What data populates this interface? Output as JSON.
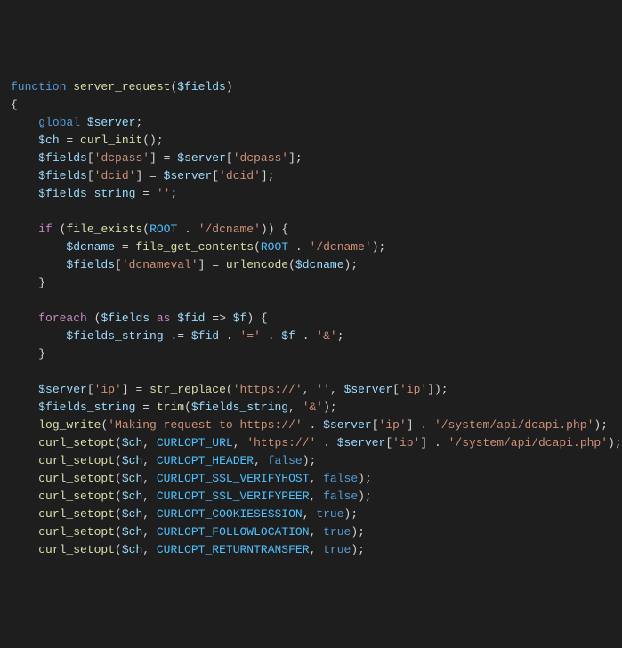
{
  "code": {
    "lines": [
      [
        {
          "t": "function ",
          "c": "keyword"
        },
        {
          "t": "server_request",
          "c": "function"
        },
        {
          "t": "(",
          "c": "punct"
        },
        {
          "t": "$fields",
          "c": "variable"
        },
        {
          "t": ")",
          "c": "punct"
        }
      ],
      [
        {
          "t": "{",
          "c": "punct"
        }
      ],
      [
        {
          "t": "    ",
          "c": "punct"
        },
        {
          "t": "global ",
          "c": "keyword"
        },
        {
          "t": "$server",
          "c": "variable"
        },
        {
          "t": ";",
          "c": "punct"
        }
      ],
      [
        {
          "t": "    ",
          "c": "punct"
        },
        {
          "t": "$ch",
          "c": "variable"
        },
        {
          "t": " = ",
          "c": "operator"
        },
        {
          "t": "curl_init",
          "c": "function"
        },
        {
          "t": "();",
          "c": "punct"
        }
      ],
      [
        {
          "t": "    ",
          "c": "punct"
        },
        {
          "t": "$fields",
          "c": "variable"
        },
        {
          "t": "[",
          "c": "punct"
        },
        {
          "t": "'dcpass'",
          "c": "string"
        },
        {
          "t": "] = ",
          "c": "punct"
        },
        {
          "t": "$server",
          "c": "variable"
        },
        {
          "t": "[",
          "c": "punct"
        },
        {
          "t": "'dcpass'",
          "c": "string"
        },
        {
          "t": "];",
          "c": "punct"
        }
      ],
      [
        {
          "t": "    ",
          "c": "punct"
        },
        {
          "t": "$fields",
          "c": "variable"
        },
        {
          "t": "[",
          "c": "punct"
        },
        {
          "t": "'dcid'",
          "c": "string"
        },
        {
          "t": "] = ",
          "c": "punct"
        },
        {
          "t": "$server",
          "c": "variable"
        },
        {
          "t": "[",
          "c": "punct"
        },
        {
          "t": "'dcid'",
          "c": "string"
        },
        {
          "t": "];",
          "c": "punct"
        }
      ],
      [
        {
          "t": "    ",
          "c": "punct"
        },
        {
          "t": "$fields_string",
          "c": "variable"
        },
        {
          "t": " = ",
          "c": "operator"
        },
        {
          "t": "''",
          "c": "string"
        },
        {
          "t": ";",
          "c": "punct"
        }
      ],
      [],
      [
        {
          "t": "    ",
          "c": "punct"
        },
        {
          "t": "if ",
          "c": "keyword-control"
        },
        {
          "t": "(",
          "c": "punct"
        },
        {
          "t": "file_exists",
          "c": "function"
        },
        {
          "t": "(",
          "c": "punct"
        },
        {
          "t": "ROOT",
          "c": "constant"
        },
        {
          "t": " . ",
          "c": "operator"
        },
        {
          "t": "'/dcname'",
          "c": "string"
        },
        {
          "t": ")) {",
          "c": "punct"
        }
      ],
      [
        {
          "t": "        ",
          "c": "punct"
        },
        {
          "t": "$dcname",
          "c": "variable"
        },
        {
          "t": " = ",
          "c": "operator"
        },
        {
          "t": "file_get_contents",
          "c": "function"
        },
        {
          "t": "(",
          "c": "punct"
        },
        {
          "t": "ROOT",
          "c": "constant"
        },
        {
          "t": " . ",
          "c": "operator"
        },
        {
          "t": "'/dcname'",
          "c": "string"
        },
        {
          "t": ");",
          "c": "punct"
        }
      ],
      [
        {
          "t": "        ",
          "c": "punct"
        },
        {
          "t": "$fields",
          "c": "variable"
        },
        {
          "t": "[",
          "c": "punct"
        },
        {
          "t": "'dcnameval'",
          "c": "string"
        },
        {
          "t": "] = ",
          "c": "punct"
        },
        {
          "t": "urlencode",
          "c": "function"
        },
        {
          "t": "(",
          "c": "punct"
        },
        {
          "t": "$dcname",
          "c": "variable"
        },
        {
          "t": ");",
          "c": "punct"
        }
      ],
      [
        {
          "t": "    }",
          "c": "punct"
        }
      ],
      [],
      [
        {
          "t": "    ",
          "c": "punct"
        },
        {
          "t": "foreach ",
          "c": "keyword-control"
        },
        {
          "t": "(",
          "c": "punct"
        },
        {
          "t": "$fields",
          "c": "variable"
        },
        {
          "t": " as ",
          "c": "keyword-control"
        },
        {
          "t": "$fid",
          "c": "variable"
        },
        {
          "t": " => ",
          "c": "operator"
        },
        {
          "t": "$f",
          "c": "variable"
        },
        {
          "t": ") {",
          "c": "punct"
        }
      ],
      [
        {
          "t": "        ",
          "c": "punct"
        },
        {
          "t": "$fields_string",
          "c": "variable"
        },
        {
          "t": " .= ",
          "c": "operator"
        },
        {
          "t": "$fid",
          "c": "variable"
        },
        {
          "t": " . ",
          "c": "operator"
        },
        {
          "t": "'='",
          "c": "string"
        },
        {
          "t": " . ",
          "c": "operator"
        },
        {
          "t": "$f",
          "c": "variable"
        },
        {
          "t": " . ",
          "c": "operator"
        },
        {
          "t": "'&'",
          "c": "string"
        },
        {
          "t": ";",
          "c": "punct"
        }
      ],
      [
        {
          "t": "    }",
          "c": "punct"
        }
      ],
      [],
      [
        {
          "t": "    ",
          "c": "punct"
        },
        {
          "t": "$server",
          "c": "variable"
        },
        {
          "t": "[",
          "c": "punct"
        },
        {
          "t": "'ip'",
          "c": "string"
        },
        {
          "t": "] = ",
          "c": "punct"
        },
        {
          "t": "str_replace",
          "c": "function"
        },
        {
          "t": "(",
          "c": "punct"
        },
        {
          "t": "'https://'",
          "c": "string"
        },
        {
          "t": ", ",
          "c": "punct"
        },
        {
          "t": "''",
          "c": "string"
        },
        {
          "t": ", ",
          "c": "punct"
        },
        {
          "t": "$server",
          "c": "variable"
        },
        {
          "t": "[",
          "c": "punct"
        },
        {
          "t": "'ip'",
          "c": "string"
        },
        {
          "t": "]);",
          "c": "punct"
        }
      ],
      [
        {
          "t": "    ",
          "c": "punct"
        },
        {
          "t": "$fields_string",
          "c": "variable"
        },
        {
          "t": " = ",
          "c": "operator"
        },
        {
          "t": "trim",
          "c": "function"
        },
        {
          "t": "(",
          "c": "punct"
        },
        {
          "t": "$fields_string",
          "c": "variable"
        },
        {
          "t": ", ",
          "c": "punct"
        },
        {
          "t": "'&'",
          "c": "string"
        },
        {
          "t": ");",
          "c": "punct"
        }
      ],
      [
        {
          "t": "    ",
          "c": "punct"
        },
        {
          "t": "log_write",
          "c": "function"
        },
        {
          "t": "(",
          "c": "punct"
        },
        {
          "t": "'Making request to https://'",
          "c": "string"
        },
        {
          "t": " . ",
          "c": "operator"
        },
        {
          "t": "$server",
          "c": "variable"
        },
        {
          "t": "[",
          "c": "punct"
        },
        {
          "t": "'ip'",
          "c": "string"
        },
        {
          "t": "] . ",
          "c": "punct"
        },
        {
          "t": "'/system/api/dcapi.php'",
          "c": "string"
        },
        {
          "t": ");",
          "c": "punct"
        }
      ],
      [
        {
          "t": "    ",
          "c": "punct"
        },
        {
          "t": "curl_setopt",
          "c": "function"
        },
        {
          "t": "(",
          "c": "punct"
        },
        {
          "t": "$ch",
          "c": "variable"
        },
        {
          "t": ", ",
          "c": "punct"
        },
        {
          "t": "CURLOPT_URL",
          "c": "constant"
        },
        {
          "t": ", ",
          "c": "punct"
        },
        {
          "t": "'https://'",
          "c": "string"
        },
        {
          "t": " . ",
          "c": "operator"
        },
        {
          "t": "$server",
          "c": "variable"
        },
        {
          "t": "[",
          "c": "punct"
        },
        {
          "t": "'ip'",
          "c": "string"
        },
        {
          "t": "] . ",
          "c": "punct"
        },
        {
          "t": "'/system/api/dcapi.php'",
          "c": "string"
        },
        {
          "t": ");",
          "c": "punct"
        }
      ],
      [
        {
          "t": "    ",
          "c": "punct"
        },
        {
          "t": "curl_setopt",
          "c": "function"
        },
        {
          "t": "(",
          "c": "punct"
        },
        {
          "t": "$ch",
          "c": "variable"
        },
        {
          "t": ", ",
          "c": "punct"
        },
        {
          "t": "CURLOPT_HEADER",
          "c": "constant"
        },
        {
          "t": ", ",
          "c": "punct"
        },
        {
          "t": "false",
          "c": "const-bool"
        },
        {
          "t": ");",
          "c": "punct"
        }
      ],
      [
        {
          "t": "    ",
          "c": "punct"
        },
        {
          "t": "curl_setopt",
          "c": "function"
        },
        {
          "t": "(",
          "c": "punct"
        },
        {
          "t": "$ch",
          "c": "variable"
        },
        {
          "t": ", ",
          "c": "punct"
        },
        {
          "t": "CURLOPT_SSL_VERIFYHOST",
          "c": "constant"
        },
        {
          "t": ", ",
          "c": "punct"
        },
        {
          "t": "false",
          "c": "const-bool"
        },
        {
          "t": ");",
          "c": "punct"
        }
      ],
      [
        {
          "t": "    ",
          "c": "punct"
        },
        {
          "t": "curl_setopt",
          "c": "function"
        },
        {
          "t": "(",
          "c": "punct"
        },
        {
          "t": "$ch",
          "c": "variable"
        },
        {
          "t": ", ",
          "c": "punct"
        },
        {
          "t": "CURLOPT_SSL_VERIFYPEER",
          "c": "constant"
        },
        {
          "t": ", ",
          "c": "punct"
        },
        {
          "t": "false",
          "c": "const-bool"
        },
        {
          "t": ");",
          "c": "punct"
        }
      ],
      [
        {
          "t": "    ",
          "c": "punct"
        },
        {
          "t": "curl_setopt",
          "c": "function"
        },
        {
          "t": "(",
          "c": "punct"
        },
        {
          "t": "$ch",
          "c": "variable"
        },
        {
          "t": ", ",
          "c": "punct"
        },
        {
          "t": "CURLOPT_COOKIESESSION",
          "c": "constant"
        },
        {
          "t": ", ",
          "c": "punct"
        },
        {
          "t": "true",
          "c": "const-bool"
        },
        {
          "t": ");",
          "c": "punct"
        }
      ],
      [
        {
          "t": "    ",
          "c": "punct"
        },
        {
          "t": "curl_setopt",
          "c": "function"
        },
        {
          "t": "(",
          "c": "punct"
        },
        {
          "t": "$ch",
          "c": "variable"
        },
        {
          "t": ", ",
          "c": "punct"
        },
        {
          "t": "CURLOPT_FOLLOWLOCATION",
          "c": "constant"
        },
        {
          "t": ", ",
          "c": "punct"
        },
        {
          "t": "true",
          "c": "const-bool"
        },
        {
          "t": ");",
          "c": "punct"
        }
      ],
      [
        {
          "t": "    ",
          "c": "punct"
        },
        {
          "t": "curl_setopt",
          "c": "function"
        },
        {
          "t": "(",
          "c": "punct"
        },
        {
          "t": "$ch",
          "c": "variable"
        },
        {
          "t": ", ",
          "c": "punct"
        },
        {
          "t": "CURLOPT_RETURNTRANSFER",
          "c": "constant"
        },
        {
          "t": ", ",
          "c": "punct"
        },
        {
          "t": "true",
          "c": "const-bool"
        },
        {
          "t": ");",
          "c": "punct"
        }
      ]
    ]
  }
}
